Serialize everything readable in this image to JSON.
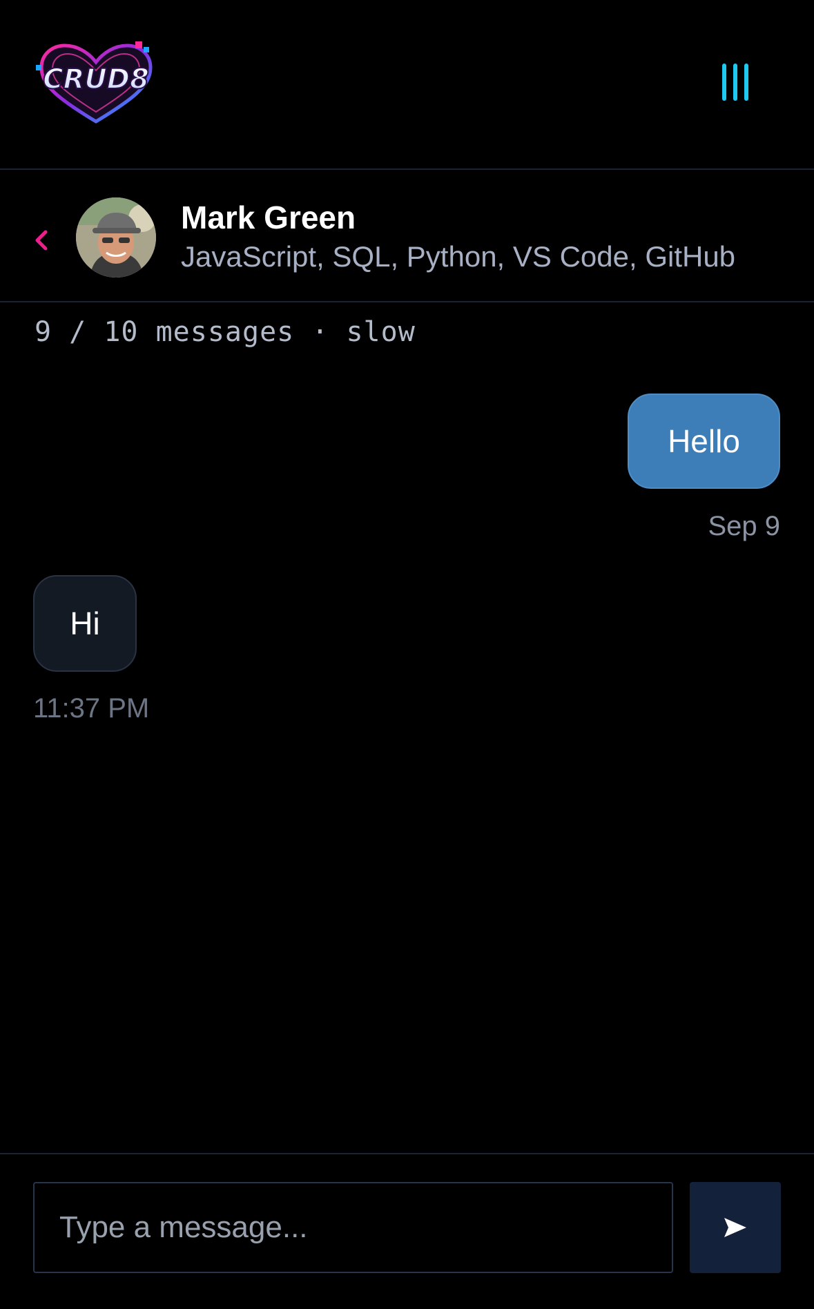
{
  "brand": {
    "logo_text": "CRUD8",
    "logo_icon": "heart-logo-icon",
    "menu_icon": "menu-bars-icon",
    "accent_color": "#1ec8f0",
    "pink_color": "#ec1f8c"
  },
  "chat_header": {
    "back_icon": "chevron-left-icon",
    "name": "Mark Green",
    "subtitle": "JavaScript, SQL, Python, VS Code, GitHub"
  },
  "meta": {
    "count_text": "9 / 10 messages · slow"
  },
  "messages": [
    {
      "direction": "outgoing",
      "text": "Hello",
      "time": "Sep 9"
    },
    {
      "direction": "incoming",
      "text": "Hi",
      "time": "11:37 PM"
    }
  ],
  "composer": {
    "placeholder": "Type a message...",
    "value": "",
    "send_icon": "send-arrow-icon"
  },
  "colors": {
    "outgoing_bubble": "#3e7eb8",
    "incoming_bubble": "#141a24",
    "send_button": "#14213a"
  }
}
